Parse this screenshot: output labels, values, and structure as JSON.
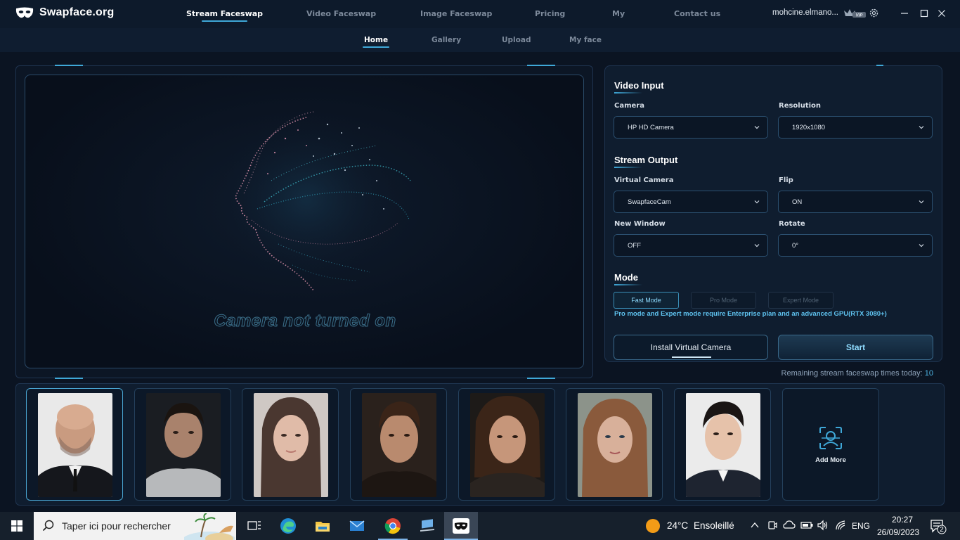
{
  "app": {
    "brand": "Swapface.org",
    "user": "mohcine.elmano...",
    "vip_badge": "VIP"
  },
  "topnav": [
    {
      "label": "Stream Faceswap",
      "active": true
    },
    {
      "label": "Video Faceswap",
      "active": false
    },
    {
      "label": "Image Faceswap",
      "active": false
    },
    {
      "label": "Pricing",
      "active": false
    },
    {
      "label": "My",
      "active": false
    },
    {
      "label": "Contact us",
      "active": false
    }
  ],
  "subnav": [
    {
      "label": "Home",
      "active": true
    },
    {
      "label": "Gallery",
      "active": false
    },
    {
      "label": "Upload",
      "active": false
    },
    {
      "label": "My face",
      "active": false
    }
  ],
  "preview": {
    "message": "Camera not turned on"
  },
  "video_input": {
    "title": "Video Input",
    "camera_label": "Camera",
    "camera_value": "HP HD Camera",
    "resolution_label": "Resolution",
    "resolution_value": "1920x1080"
  },
  "stream_output": {
    "title": "Stream Output",
    "virtual_camera_label": "Virtual Camera",
    "virtual_camera_value": "SwapfaceCam",
    "flip_label": "Flip",
    "flip_value": "ON",
    "new_window_label": "New Window",
    "new_window_value": "OFF",
    "rotate_label": "Rotate",
    "rotate_value": "0°"
  },
  "mode": {
    "title": "Mode",
    "options": [
      "Fast Mode",
      "Pro Mode",
      "Expert Mode"
    ],
    "selected": "Fast Mode",
    "note": "Pro mode and Expert mode require Enterprise plan and an advanced GPU(RTX 3080+)"
  },
  "actions": {
    "install_label": "Install Virtual Camera",
    "start_label": "Start",
    "remaining_label": "Remaining stream faceswap times today:",
    "remaining_value": "10"
  },
  "faces": {
    "count": 7,
    "selected_index": 0,
    "add_more_label": "Add More"
  },
  "taskbar": {
    "search_placeholder": "Taper ici pour rechercher",
    "weather_temp": "24°C",
    "weather_text": "Ensoleillé",
    "language": "ENG",
    "time": "20:27",
    "date": "26/09/2023",
    "notifications": "2"
  },
  "colors": {
    "accent": "#3fa8d8",
    "accent_light": "#8fdcff",
    "background": "#0b1422",
    "panel": "#0f1d2f"
  }
}
